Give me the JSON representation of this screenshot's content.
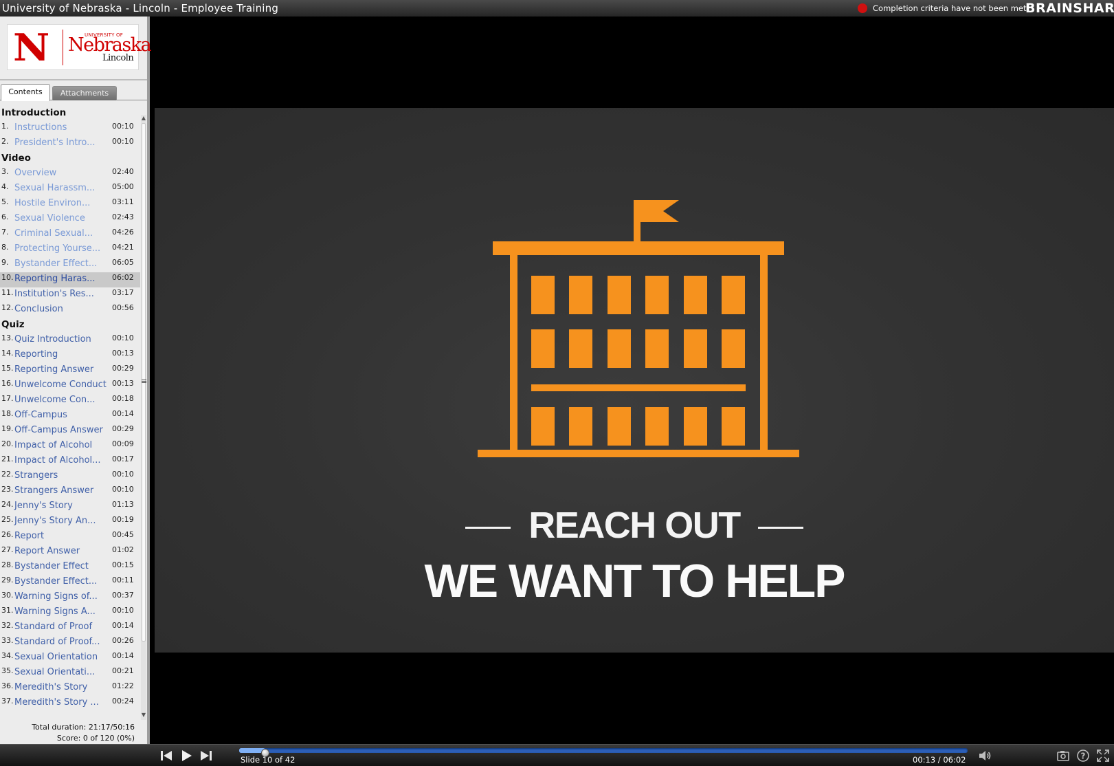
{
  "window": {
    "title": "University of Nebraska - Lincoln - Employee Training",
    "completion_status": "Completion criteria have not been met",
    "status_color": "#d01010",
    "brand": "BRAINSHARK"
  },
  "logo": {
    "letter": "N",
    "university_of": "UNIVERSITY OF",
    "name": "Nebraska",
    "campus": "Lincoln",
    "color": "#d00000"
  },
  "tabs": {
    "contents": "Contents",
    "attachments": "Attachments"
  },
  "toc": {
    "sections": [
      {
        "name": "Introduction"
      },
      {
        "name": "Video"
      },
      {
        "name": "Quiz"
      }
    ],
    "slides": [
      {
        "num": "1.",
        "title": "Instructions",
        "duration": "00:10"
      },
      {
        "num": "2.",
        "title": "President's Intro...",
        "duration": "00:10"
      },
      {
        "num": "3.",
        "title": "Overview",
        "duration": "02:40"
      },
      {
        "num": "4.",
        "title": "Sexual Harassm...",
        "duration": "05:00"
      },
      {
        "num": "5.",
        "title": "Hostile Environ...",
        "duration": "03:11"
      },
      {
        "num": "6.",
        "title": "Sexual Violence",
        "duration": "02:43"
      },
      {
        "num": "7.",
        "title": "Criminal Sexual...",
        "duration": "04:26"
      },
      {
        "num": "8.",
        "title": "Protecting Yourse...",
        "duration": "04:21"
      },
      {
        "num": "9.",
        "title": "Bystander Effect...",
        "duration": "06:05"
      },
      {
        "num": "10.",
        "title": "Reporting Haras...",
        "duration": "06:02"
      },
      {
        "num": "11.",
        "title": "Institution's Res...",
        "duration": "03:17"
      },
      {
        "num": "12.",
        "title": "Conclusion",
        "duration": "00:56"
      },
      {
        "num": "13.",
        "title": "Quiz Introduction",
        "duration": "00:10"
      },
      {
        "num": "14.",
        "title": "Reporting",
        "duration": "00:13"
      },
      {
        "num": "15.",
        "title": "Reporting Answer",
        "duration": "00:29"
      },
      {
        "num": "16.",
        "title": "Unwelcome Conduct",
        "duration": "00:13"
      },
      {
        "num": "17.",
        "title": "Unwelcome Con...",
        "duration": "00:18"
      },
      {
        "num": "18.",
        "title": "Off-Campus",
        "duration": "00:14"
      },
      {
        "num": "19.",
        "title": "Off-Campus Answer",
        "duration": "00:29"
      },
      {
        "num": "20.",
        "title": "Impact of Alcohol",
        "duration": "00:09"
      },
      {
        "num": "21.",
        "title": "Impact of Alcohol...",
        "duration": "00:17"
      },
      {
        "num": "22.",
        "title": "Strangers",
        "duration": "00:10"
      },
      {
        "num": "23.",
        "title": "Strangers Answer",
        "duration": "00:10"
      },
      {
        "num": "24.",
        "title": "Jenny's Story",
        "duration": "01:13"
      },
      {
        "num": "25.",
        "title": "Jenny's Story An...",
        "duration": "00:19"
      },
      {
        "num": "26.",
        "title": "Report",
        "duration": "00:45"
      },
      {
        "num": "27.",
        "title": "Report Answer",
        "duration": "01:02"
      },
      {
        "num": "28.",
        "title": "Bystander Effect",
        "duration": "00:15"
      },
      {
        "num": "29.",
        "title": "Bystander Effect...",
        "duration": "00:11"
      },
      {
        "num": "30.",
        "title": "Warning Signs of...",
        "duration": "00:37"
      },
      {
        "num": "31.",
        "title": "Warning Signs A...",
        "duration": "00:10"
      },
      {
        "num": "32.",
        "title": "Standard of Proof",
        "duration": "00:14"
      },
      {
        "num": "33.",
        "title": "Standard of Proof...",
        "duration": "00:26"
      },
      {
        "num": "34.",
        "title": "Sexual Orientation",
        "duration": "00:14"
      },
      {
        "num": "35.",
        "title": "Sexual Orientati...",
        "duration": "00:21"
      },
      {
        "num": "36.",
        "title": "Meredith's Story",
        "duration": "01:22"
      },
      {
        "num": "37.",
        "title": "Meredith's Story ...",
        "duration": "00:24"
      }
    ],
    "current_slide_number": 10,
    "total_duration": "Total duration: 21:17/50:16",
    "score": "Score: 0 of 120 (0%)"
  },
  "slide": {
    "line1": "REACH OUT",
    "line2": "WE WANT TO HELP",
    "accent_color": "#f6921e",
    "icon": "building-flag-icon"
  },
  "player": {
    "slide_counter": "Slide 10 of 42",
    "time": "00:13 / 06:02",
    "progress_fraction": 0.036,
    "icons": [
      "previous-icon",
      "play-icon",
      "next-icon",
      "volume-icon",
      "snapshot-icon",
      "help-icon",
      "fullscreen-icon"
    ]
  }
}
